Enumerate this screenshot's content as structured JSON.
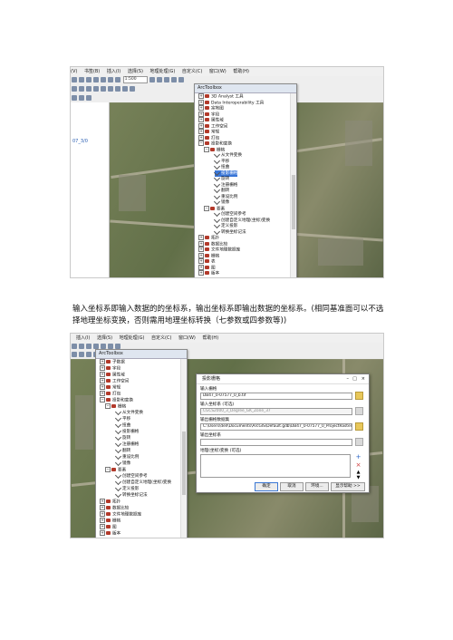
{
  "shot1": {
    "menu": [
      "(V)",
      "书签(B)",
      "插入(I)",
      "选择(S)",
      "地理处理(G)",
      "自定义(C)",
      "窗口(W)",
      "帮助(H)"
    ],
    "scale_value": "1:500",
    "side_label": "07_3/0",
    "toolbox_title": "ArcToolbox",
    "tree": [
      {
        "label": "3D Analyst 工具",
        "type": "folder"
      },
      {
        "label": "Data Interoperability 工具",
        "type": "folder"
      },
      {
        "label": "宗地图",
        "type": "folder"
      },
      {
        "label": "字段",
        "type": "folder"
      },
      {
        "label": "属性域",
        "type": "folder"
      },
      {
        "label": "工作空间",
        "type": "folder"
      },
      {
        "label": "常规",
        "type": "folder"
      },
      {
        "label": "打包",
        "type": "folder"
      },
      {
        "label": "投影和变换",
        "type": "folder-open"
      },
      {
        "label": "栅格",
        "type": "folder-open"
      },
      {
        "label": "从文件变换",
        "type": "tool"
      },
      {
        "label": "平移",
        "type": "tool"
      },
      {
        "label": "扭曲",
        "type": "tool"
      },
      {
        "label": "投影栅格",
        "type": "tool-selected"
      },
      {
        "label": "旋转",
        "type": "tool"
      },
      {
        "label": "注册栅格",
        "type": "tool"
      },
      {
        "label": "翻转",
        "type": "tool"
      },
      {
        "label": "重设比例",
        "type": "tool"
      },
      {
        "label": "镜像",
        "type": "tool"
      },
      {
        "label": "要素",
        "type": "folder-open"
      },
      {
        "label": "创建空间参考",
        "type": "tool"
      },
      {
        "label": "创建自定义地理(坐标)变换",
        "type": "tool"
      },
      {
        "label": "定义投影",
        "type": "tool"
      },
      {
        "label": "转换坐标记法",
        "type": "tool"
      },
      {
        "label": "拓扑",
        "type": "folder"
      },
      {
        "label": "数据比较",
        "type": "folder"
      },
      {
        "label": "文件地理数据库",
        "type": "folder"
      },
      {
        "label": "栅格",
        "type": "folder"
      },
      {
        "label": "表",
        "type": "folder"
      },
      {
        "label": "图",
        "type": "folder"
      },
      {
        "label": "版本",
        "type": "folder"
      }
    ]
  },
  "caption": "输入坐标系即输入数据的的坐标系，输出坐标系即输出数据的坐标系。(相同基准面可以不选择地理坐标变换，否则需用地理坐标转换（七参数或四参数等))",
  "shot2": {
    "menu": [
      "插入(I)",
      "选择(S)",
      "地理处理(G)",
      "自定义(C)",
      "窗口(W)",
      "帮助(H)"
    ],
    "toolbox_title": "ArcToolbox",
    "tree": [
      {
        "label": "子数据",
        "type": "folder"
      },
      {
        "label": "字段",
        "type": "folder"
      },
      {
        "label": "属性域",
        "type": "folder"
      },
      {
        "label": "工作空间",
        "type": "folder"
      },
      {
        "label": "常规",
        "type": "folder"
      },
      {
        "label": "打包",
        "type": "folder"
      },
      {
        "label": "投影和变换",
        "type": "folder-open"
      },
      {
        "label": "栅格",
        "type": "folder-open"
      },
      {
        "label": "从文件变换",
        "type": "tool"
      },
      {
        "label": "平移",
        "type": "tool"
      },
      {
        "label": "扭曲",
        "type": "tool"
      },
      {
        "label": "投影栅格",
        "type": "tool"
      },
      {
        "label": "旋转",
        "type": "tool"
      },
      {
        "label": "注册栅格",
        "type": "tool"
      },
      {
        "label": "翻转",
        "type": "tool"
      },
      {
        "label": "重设比例",
        "type": "tool"
      },
      {
        "label": "镜像",
        "type": "tool"
      },
      {
        "label": "要素",
        "type": "folder-open"
      },
      {
        "label": "创建空间参考",
        "type": "tool"
      },
      {
        "label": "创建自定义地理(坐标)变换",
        "type": "tool"
      },
      {
        "label": "定义投影",
        "type": "tool"
      },
      {
        "label": "转换坐标记法",
        "type": "tool"
      },
      {
        "label": "拓扑",
        "type": "folder"
      },
      {
        "label": "数据比较",
        "type": "folder"
      },
      {
        "label": "文件地理数据库",
        "type": "folder"
      },
      {
        "label": "栅格",
        "type": "folder"
      },
      {
        "label": "图",
        "type": "folder"
      },
      {
        "label": "版本",
        "type": "folder"
      }
    ],
    "dialog": {
      "title": "投影栅格",
      "input_label": "输入栅格",
      "input_value": "DB47_0-07577_0_b.tif",
      "input_cs_label": "输入坐标系 (可选)",
      "input_cs_value": "CGCS2000_3_Degree_GK_Zone_37",
      "output_label": "输出栅格数据集",
      "output_value": "C:\\Users\\dell\\Documents\\ArcGIS\\Default.gdb\\DB47_0-07577_0_ProjectRaster",
      "output_cs_label": "输出坐标系",
      "geo_transform_label": "地理(坐标)变换 (可选)",
      "buttons": {
        "ok": "确定",
        "cancel": "取消",
        "env": "环境...",
        "help": "显示帮助 >>"
      }
    }
  }
}
